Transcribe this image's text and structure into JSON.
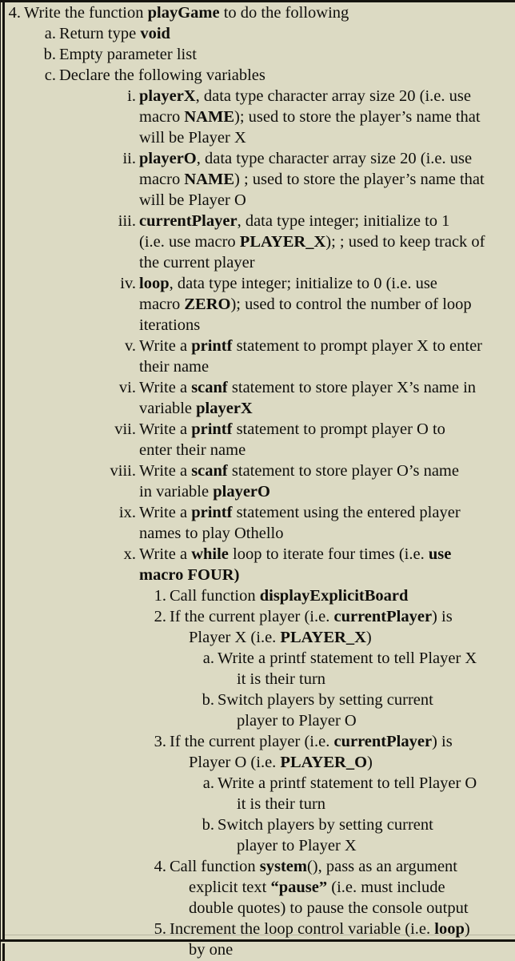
{
  "document": {
    "background_color": "#dcdac3",
    "rule_color": "#15140f",
    "text_color": "#100f0c"
  },
  "lines": [
    {
      "id": "l01",
      "level": 1,
      "marker": "4.",
      "segments": [
        {
          "t": "Write the function ",
          "b": false
        },
        {
          "t": "playGame",
          "b": true
        },
        {
          "t": " to do the following",
          "b": false
        }
      ]
    },
    {
      "id": "l02",
      "level": 2,
      "marker": "a.",
      "segments": [
        {
          "t": "Return type ",
          "b": false
        },
        {
          "t": "void",
          "b": true
        }
      ]
    },
    {
      "id": "l03",
      "level": 2,
      "marker": "b.",
      "segments": [
        {
          "t": "Empty parameter list",
          "b": false
        }
      ]
    },
    {
      "id": "l04",
      "level": 2,
      "marker": "c.",
      "segments": [
        {
          "t": "Declare the following variables",
          "b": false
        }
      ]
    },
    {
      "id": "l05",
      "level": 3,
      "marker": "i.",
      "segments": [
        {
          "t": "playerX",
          "b": true
        },
        {
          "t": ", data type character array size 20 (i.e. use",
          "b": false
        }
      ]
    },
    {
      "id": "l06",
      "level": 0,
      "cont": "cont3",
      "segments": [
        {
          "t": "macro ",
          "b": false
        },
        {
          "t": "NAME",
          "b": true
        },
        {
          "t": "); used to store the player’s name that",
          "b": false
        }
      ]
    },
    {
      "id": "l07",
      "level": 0,
      "cont": "cont3",
      "segments": [
        {
          "t": "will be Player X",
          "b": false
        }
      ]
    },
    {
      "id": "l08",
      "level": 3,
      "marker": "ii.",
      "segments": [
        {
          "t": "playerO",
          "b": true
        },
        {
          "t": ", data type character array size 20 (i.e. use",
          "b": false
        }
      ]
    },
    {
      "id": "l09",
      "level": 0,
      "cont": "cont3",
      "segments": [
        {
          "t": "macro ",
          "b": false
        },
        {
          "t": "NAME",
          "b": true
        },
        {
          "t": ") ; used to store the player’s name that",
          "b": false
        }
      ]
    },
    {
      "id": "l10",
      "level": 0,
      "cont": "cont3",
      "segments": [
        {
          "t": "will be Player O",
          "b": false
        }
      ]
    },
    {
      "id": "l11",
      "level": 3,
      "marker": "iii.",
      "segments": [
        {
          "t": "currentPlayer",
          "b": true
        },
        {
          "t": ", data type integer; initialize to 1",
          "b": false
        }
      ]
    },
    {
      "id": "l12",
      "level": 0,
      "cont": "cont3",
      "segments": [
        {
          "t": "(i.e. use macro ",
          "b": false
        },
        {
          "t": "PLAYER_X",
          "b": true
        },
        {
          "t": "); ; used to keep track of",
          "b": false
        }
      ]
    },
    {
      "id": "l13",
      "level": 0,
      "cont": "cont3",
      "segments": [
        {
          "t": "the current player",
          "b": false
        }
      ]
    },
    {
      "id": "l14",
      "level": 3,
      "marker": "iv.",
      "segments": [
        {
          "t": "loop",
          "b": true
        },
        {
          "t": ", data type integer; initialize to 0 (i.e. use",
          "b": false
        }
      ]
    },
    {
      "id": "l15",
      "level": 0,
      "cont": "cont3",
      "segments": [
        {
          "t": "macro ",
          "b": false
        },
        {
          "t": "ZERO",
          "b": true
        },
        {
          "t": "); used to control the number of loop",
          "b": false
        }
      ]
    },
    {
      "id": "l16",
      "level": 0,
      "cont": "cont3",
      "segments": [
        {
          "t": "iterations",
          "b": false
        }
      ]
    },
    {
      "id": "l17",
      "level": 3,
      "marker": "v.",
      "segments": [
        {
          "t": "Write a ",
          "b": false
        },
        {
          "t": "printf",
          "b": true
        },
        {
          "t": " statement to prompt player X to enter",
          "b": false
        }
      ]
    },
    {
      "id": "l18",
      "level": 0,
      "cont": "cont3",
      "segments": [
        {
          "t": "their name",
          "b": false
        }
      ]
    },
    {
      "id": "l19",
      "level": 3,
      "marker": "vi.",
      "segments": [
        {
          "t": "Write a ",
          "b": false
        },
        {
          "t": "scanf",
          "b": true
        },
        {
          "t": " statement to store player X’s name in",
          "b": false
        }
      ]
    },
    {
      "id": "l20",
      "level": 0,
      "cont": "cont3",
      "segments": [
        {
          "t": "variable ",
          "b": false
        },
        {
          "t": "playerX",
          "b": true
        }
      ]
    },
    {
      "id": "l21",
      "level": 3,
      "marker": "vii.",
      "segments": [
        {
          "t": "Write a ",
          "b": false
        },
        {
          "t": "printf",
          "b": true
        },
        {
          "t": " statement to prompt player O to",
          "b": false
        }
      ]
    },
    {
      "id": "l22",
      "level": 0,
      "cont": "cont3",
      "segments": [
        {
          "t": "enter their name",
          "b": false
        }
      ]
    },
    {
      "id": "l23",
      "level": 3,
      "marker": "viii.",
      "segments": [
        {
          "t": "Write a ",
          "b": false
        },
        {
          "t": "scanf",
          "b": true
        },
        {
          "t": " statement to store player O’s name",
          "b": false
        }
      ]
    },
    {
      "id": "l24",
      "level": 0,
      "cont": "cont3",
      "segments": [
        {
          "t": "in variable ",
          "b": false
        },
        {
          "t": "playerO",
          "b": true
        }
      ]
    },
    {
      "id": "l25",
      "level": 3,
      "marker": "ix.",
      "segments": [
        {
          "t": "Write a ",
          "b": false
        },
        {
          "t": "printf",
          "b": true
        },
        {
          "t": " statement using the entered player",
          "b": false
        }
      ]
    },
    {
      "id": "l26",
      "level": 0,
      "cont": "cont3",
      "segments": [
        {
          "t": "names to play Othello",
          "b": false
        }
      ]
    },
    {
      "id": "l27",
      "level": 3,
      "marker": "x.",
      "segments": [
        {
          "t": "Write a ",
          "b": false
        },
        {
          "t": "while",
          "b": true
        },
        {
          "t": " loop to iterate four times (i.e. ",
          "b": false
        },
        {
          "t": "use",
          "b": true
        }
      ]
    },
    {
      "id": "l28",
      "level": 0,
      "cont": "cont3",
      "segments": [
        {
          "t": "macro FOUR)",
          "b": true
        }
      ]
    },
    {
      "id": "l29",
      "level": 4,
      "marker": "1.",
      "segments": [
        {
          "t": "Call function ",
          "b": false
        },
        {
          "t": "displayExplicitBoard",
          "b": true
        }
      ]
    },
    {
      "id": "l30",
      "level": 4,
      "marker": "2.",
      "segments": [
        {
          "t": "If the current player (i.e. ",
          "b": false
        },
        {
          "t": "currentPlayer",
          "b": true
        },
        {
          "t": ") is",
          "b": false
        }
      ]
    },
    {
      "id": "l31",
      "level": 0,
      "cont": "cont4",
      "segments": [
        {
          "t": "Player X (i.e. ",
          "b": false
        },
        {
          "t": "PLAYER_X",
          "b": true
        },
        {
          "t": ")",
          "b": false
        }
      ]
    },
    {
      "id": "l32",
      "level": 5,
      "marker": "a.",
      "segments": [
        {
          "t": "Write a printf statement to tell Player X",
          "b": false
        }
      ]
    },
    {
      "id": "l33",
      "level": 0,
      "cont": "cont5",
      "segments": [
        {
          "t": "it is their turn",
          "b": false
        }
      ]
    },
    {
      "id": "l34",
      "level": 5,
      "marker": "b.",
      "segments": [
        {
          "t": "Switch players by setting current",
          "b": false
        }
      ]
    },
    {
      "id": "l35",
      "level": 0,
      "cont": "cont5",
      "segments": [
        {
          "t": "player to Player O",
          "b": false
        }
      ]
    },
    {
      "id": "l36",
      "level": 4,
      "marker": "3.",
      "segments": [
        {
          "t": "If the current player (i.e. ",
          "b": false
        },
        {
          "t": "currentPlayer",
          "b": true
        },
        {
          "t": ") is",
          "b": false
        }
      ]
    },
    {
      "id": "l37",
      "level": 0,
      "cont": "cont4",
      "segments": [
        {
          "t": "Player O (i.e. ",
          "b": false
        },
        {
          "t": "PLAYER_O",
          "b": true
        },
        {
          "t": ")",
          "b": false
        }
      ]
    },
    {
      "id": "l38",
      "level": 5,
      "marker": "a.",
      "segments": [
        {
          "t": "Write a printf statement to tell Player O",
          "b": false
        }
      ]
    },
    {
      "id": "l39",
      "level": 0,
      "cont": "cont5",
      "segments": [
        {
          "t": "it is their turn",
          "b": false
        }
      ]
    },
    {
      "id": "l40",
      "level": 5,
      "marker": "b.",
      "segments": [
        {
          "t": "Switch players by setting current",
          "b": false
        }
      ]
    },
    {
      "id": "l41",
      "level": 0,
      "cont": "cont5",
      "segments": [
        {
          "t": "player to Player X",
          "b": false
        }
      ]
    },
    {
      "id": "l42",
      "level": 4,
      "marker": "4.",
      "segments": [
        {
          "t": "Call function ",
          "b": false
        },
        {
          "t": "system",
          "b": true
        },
        {
          "t": "(), pass as an argument",
          "b": false
        }
      ]
    },
    {
      "id": "l43",
      "level": 0,
      "cont": "cont4",
      "segments": [
        {
          "t": "explicit text ",
          "b": false
        },
        {
          "t": "“pause”",
          "b": true
        },
        {
          "t": " (i.e. must include",
          "b": false
        }
      ]
    },
    {
      "id": "l44",
      "level": 0,
      "cont": "cont4",
      "segments": [
        {
          "t": "double quotes) to pause the console output",
          "b": false
        }
      ]
    },
    {
      "id": "l45",
      "level": 4,
      "marker": "5.",
      "segments": [
        {
          "t": "Increment the loop control variable (i.e. ",
          "b": false
        },
        {
          "t": "loop",
          "b": true
        },
        {
          "t": ")",
          "b": false
        }
      ]
    },
    {
      "id": "l46",
      "level": 0,
      "cont": "cont4",
      "segments": [
        {
          "t": "by one",
          "b": false
        }
      ]
    }
  ]
}
